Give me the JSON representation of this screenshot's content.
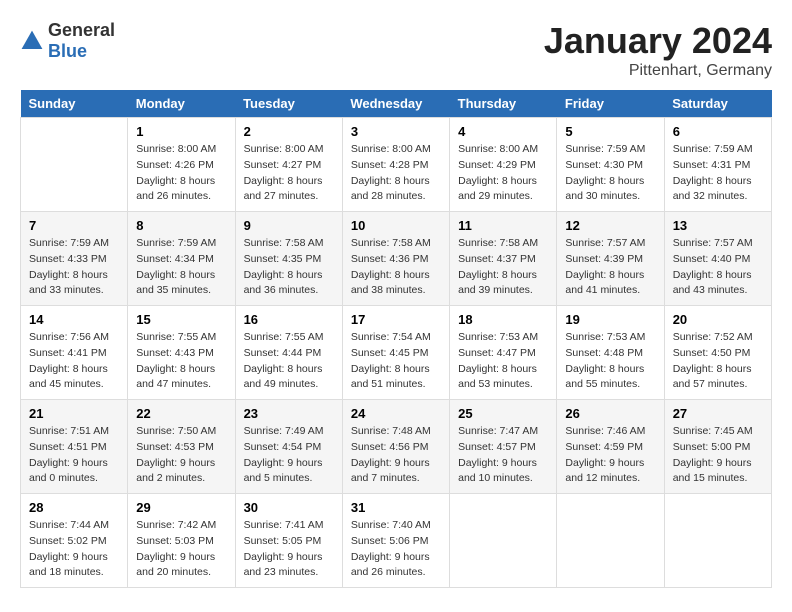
{
  "header": {
    "logo_general": "General",
    "logo_blue": "Blue",
    "title": "January 2024",
    "location": "Pittenhart, Germany"
  },
  "days_of_week": [
    "Sunday",
    "Monday",
    "Tuesday",
    "Wednesday",
    "Thursday",
    "Friday",
    "Saturday"
  ],
  "weeks": [
    [
      {
        "day": "",
        "info": ""
      },
      {
        "day": "1",
        "info": "Sunrise: 8:00 AM\nSunset: 4:26 PM\nDaylight: 8 hours\nand 26 minutes."
      },
      {
        "day": "2",
        "info": "Sunrise: 8:00 AM\nSunset: 4:27 PM\nDaylight: 8 hours\nand 27 minutes."
      },
      {
        "day": "3",
        "info": "Sunrise: 8:00 AM\nSunset: 4:28 PM\nDaylight: 8 hours\nand 28 minutes."
      },
      {
        "day": "4",
        "info": "Sunrise: 8:00 AM\nSunset: 4:29 PM\nDaylight: 8 hours\nand 29 minutes."
      },
      {
        "day": "5",
        "info": "Sunrise: 7:59 AM\nSunset: 4:30 PM\nDaylight: 8 hours\nand 30 minutes."
      },
      {
        "day": "6",
        "info": "Sunrise: 7:59 AM\nSunset: 4:31 PM\nDaylight: 8 hours\nand 32 minutes."
      }
    ],
    [
      {
        "day": "7",
        "info": "Sunrise: 7:59 AM\nSunset: 4:33 PM\nDaylight: 8 hours\nand 33 minutes."
      },
      {
        "day": "8",
        "info": "Sunrise: 7:59 AM\nSunset: 4:34 PM\nDaylight: 8 hours\nand 35 minutes."
      },
      {
        "day": "9",
        "info": "Sunrise: 7:58 AM\nSunset: 4:35 PM\nDaylight: 8 hours\nand 36 minutes."
      },
      {
        "day": "10",
        "info": "Sunrise: 7:58 AM\nSunset: 4:36 PM\nDaylight: 8 hours\nand 38 minutes."
      },
      {
        "day": "11",
        "info": "Sunrise: 7:58 AM\nSunset: 4:37 PM\nDaylight: 8 hours\nand 39 minutes."
      },
      {
        "day": "12",
        "info": "Sunrise: 7:57 AM\nSunset: 4:39 PM\nDaylight: 8 hours\nand 41 minutes."
      },
      {
        "day": "13",
        "info": "Sunrise: 7:57 AM\nSunset: 4:40 PM\nDaylight: 8 hours\nand 43 minutes."
      }
    ],
    [
      {
        "day": "14",
        "info": "Sunrise: 7:56 AM\nSunset: 4:41 PM\nDaylight: 8 hours\nand 45 minutes."
      },
      {
        "day": "15",
        "info": "Sunrise: 7:55 AM\nSunset: 4:43 PM\nDaylight: 8 hours\nand 47 minutes."
      },
      {
        "day": "16",
        "info": "Sunrise: 7:55 AM\nSunset: 4:44 PM\nDaylight: 8 hours\nand 49 minutes."
      },
      {
        "day": "17",
        "info": "Sunrise: 7:54 AM\nSunset: 4:45 PM\nDaylight: 8 hours\nand 51 minutes."
      },
      {
        "day": "18",
        "info": "Sunrise: 7:53 AM\nSunset: 4:47 PM\nDaylight: 8 hours\nand 53 minutes."
      },
      {
        "day": "19",
        "info": "Sunrise: 7:53 AM\nSunset: 4:48 PM\nDaylight: 8 hours\nand 55 minutes."
      },
      {
        "day": "20",
        "info": "Sunrise: 7:52 AM\nSunset: 4:50 PM\nDaylight: 8 hours\nand 57 minutes."
      }
    ],
    [
      {
        "day": "21",
        "info": "Sunrise: 7:51 AM\nSunset: 4:51 PM\nDaylight: 9 hours\nand 0 minutes."
      },
      {
        "day": "22",
        "info": "Sunrise: 7:50 AM\nSunset: 4:53 PM\nDaylight: 9 hours\nand 2 minutes."
      },
      {
        "day": "23",
        "info": "Sunrise: 7:49 AM\nSunset: 4:54 PM\nDaylight: 9 hours\nand 5 minutes."
      },
      {
        "day": "24",
        "info": "Sunrise: 7:48 AM\nSunset: 4:56 PM\nDaylight: 9 hours\nand 7 minutes."
      },
      {
        "day": "25",
        "info": "Sunrise: 7:47 AM\nSunset: 4:57 PM\nDaylight: 9 hours\nand 10 minutes."
      },
      {
        "day": "26",
        "info": "Sunrise: 7:46 AM\nSunset: 4:59 PM\nDaylight: 9 hours\nand 12 minutes."
      },
      {
        "day": "27",
        "info": "Sunrise: 7:45 AM\nSunset: 5:00 PM\nDaylight: 9 hours\nand 15 minutes."
      }
    ],
    [
      {
        "day": "28",
        "info": "Sunrise: 7:44 AM\nSunset: 5:02 PM\nDaylight: 9 hours\nand 18 minutes."
      },
      {
        "day": "29",
        "info": "Sunrise: 7:42 AM\nSunset: 5:03 PM\nDaylight: 9 hours\nand 20 minutes."
      },
      {
        "day": "30",
        "info": "Sunrise: 7:41 AM\nSunset: 5:05 PM\nDaylight: 9 hours\nand 23 minutes."
      },
      {
        "day": "31",
        "info": "Sunrise: 7:40 AM\nSunset: 5:06 PM\nDaylight: 9 hours\nand 26 minutes."
      },
      {
        "day": "",
        "info": ""
      },
      {
        "day": "",
        "info": ""
      },
      {
        "day": "",
        "info": ""
      }
    ]
  ]
}
